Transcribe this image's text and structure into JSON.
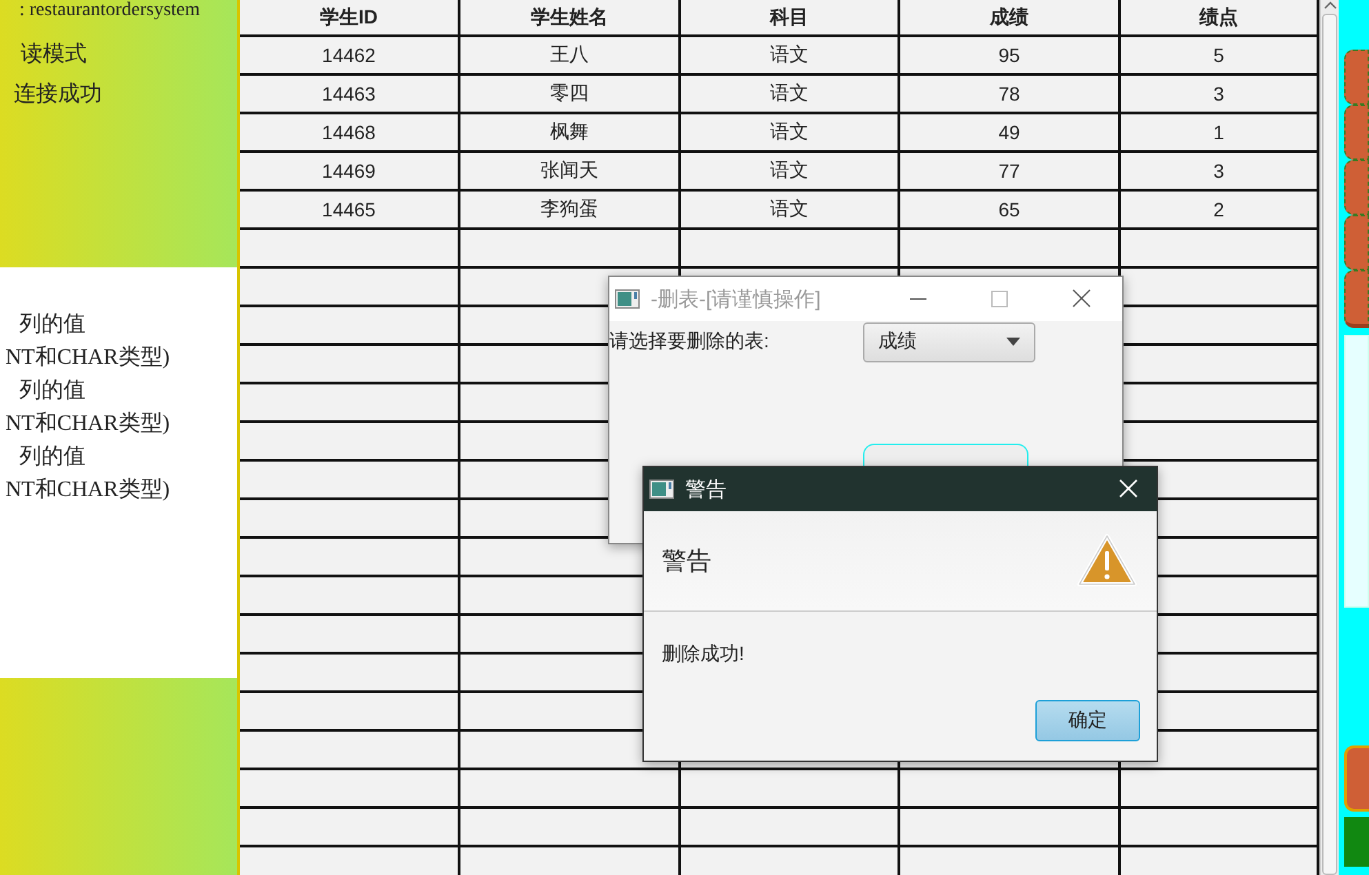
{
  "left_panel": {
    "info_lines": [
      ": restaurantordersystem",
      "读模式",
      "连接成功"
    ],
    "log_lines": [
      "列的值",
      "NT和CHAR类型)",
      "列的值",
      "NT和CHAR类型)",
      "列的值",
      "NT和CHAR类型)"
    ]
  },
  "table": {
    "columns": [
      "学生ID",
      "学生姓名",
      "科目",
      "成绩",
      "绩点"
    ],
    "rows": [
      [
        "14462",
        "王八",
        "语文",
        "95",
        "5"
      ],
      [
        "14463",
        "零四",
        "语文",
        "78",
        "3"
      ],
      [
        "14468",
        "枫舞",
        "语文",
        "49",
        "1"
      ],
      [
        "14469",
        "张闻天",
        "语文",
        "77",
        "3"
      ],
      [
        "14465",
        "李狗蛋",
        "语文",
        "65",
        "2"
      ]
    ]
  },
  "delete_dialog": {
    "title": "-删表-[请谨慎操作]",
    "prompt": "请选择要删除的表:",
    "table_select": {
      "value": "成绩"
    }
  },
  "alert_dialog": {
    "title": "警告",
    "header": "警告",
    "message": "删除成功!",
    "button": "确定"
  }
}
